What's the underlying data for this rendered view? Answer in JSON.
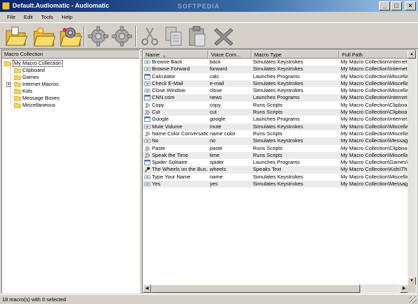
{
  "window": {
    "title": "Default.Audiomatic - Audiomatic",
    "watermark": "SOFTPEDIA",
    "controls": [
      "_",
      "□",
      "×"
    ]
  },
  "menu": [
    "File",
    "Edit",
    "Tools",
    "Help"
  ],
  "toolbar": {
    "buttons": [
      {
        "name": "open-collection",
        "icon": "open-folder-icon"
      },
      {
        "name": "new-folder",
        "icon": "new-folder-icon"
      },
      {
        "name": "folder-settings",
        "icon": "folder-gear-icon"
      },
      {
        "name": "run-macro",
        "icon": "gear-icon"
      },
      {
        "name": "record-macro",
        "icon": "gear-icon"
      },
      {
        "name": "cut",
        "icon": "scissors-icon"
      },
      {
        "name": "copy",
        "icon": "copy-icon"
      },
      {
        "name": "paste",
        "icon": "paste-icon"
      },
      {
        "name": "delete",
        "icon": "delete-x-icon"
      }
    ]
  },
  "tree": {
    "header": "Macro Collection",
    "root": "My Macro Collection",
    "children": [
      "Clipboard",
      "Games",
      "Internet Macros",
      "Kids",
      "Message Boxes",
      "Miscellaneous"
    ],
    "expand_symbol": "+"
  },
  "list": {
    "columns": [
      "Name",
      "Voice Com...",
      "Macro Type",
      "Full Path"
    ],
    "rows": [
      {
        "name": "Browse Back",
        "voice": "back",
        "type": "Simulates Keystrokes",
        "path": "My Macro Collection\\Internet Macro",
        "icon": "keyboard-icon"
      },
      {
        "name": "Browse Forward",
        "voice": "forward",
        "type": "Simulates Keystrokes",
        "path": "My Macro Collection\\Internet Macro",
        "icon": "keyboard-icon"
      },
      {
        "name": "Calculator",
        "voice": "calc",
        "type": "Launches Programs",
        "path": "My Macro Collection\\Miscellaneous\\",
        "icon": "program-icon"
      },
      {
        "name": "Check E-Mail",
        "voice": "e-mail",
        "type": "Simulates Keystrokes",
        "path": "My Macro Collection\\Miscellaneous\\C",
        "icon": "keyboard-icon"
      },
      {
        "name": "Close Window",
        "voice": "close",
        "type": "Simulates Keystrokes",
        "path": "My Macro Collection\\Miscellaneous\\",
        "icon": "keyboard-icon"
      },
      {
        "name": "CNN.com",
        "voice": "news",
        "type": "Launches Programs",
        "path": "My Macro Collection\\Internet Macro",
        "icon": "program-icon"
      },
      {
        "name": "Copy",
        "voice": "copy",
        "type": "Runs Scripts",
        "path": "My Macro Collection\\Clipboard\\Copy",
        "icon": "script-icon"
      },
      {
        "name": "Cut",
        "voice": "cut",
        "type": "Runs Scripts",
        "path": "My Macro Collection\\Clipboard\\Cut\\",
        "icon": "script-icon"
      },
      {
        "name": "Google",
        "voice": "google",
        "type": "Launches Programs",
        "path": "My Macro Collection\\Internet Macro",
        "icon": "program-icon"
      },
      {
        "name": "Mute Volume",
        "voice": "mute",
        "type": "Simulates Keystrokes",
        "path": "My Macro Collection\\Miscellaneous\\",
        "icon": "keyboard-icon"
      },
      {
        "name": "Name Color Conversation",
        "voice": "name color",
        "type": "Runs Scripts",
        "path": "My Macro Collection\\Miscellaneous\\",
        "icon": "script-icon"
      },
      {
        "name": "No",
        "voice": "no",
        "type": "Simulates Keystrokes",
        "path": "My Macro Collection\\Message Boxe",
        "icon": "keyboard-icon"
      },
      {
        "name": "Paste",
        "voice": "paste",
        "type": "Runs Scripts",
        "path": "My Macro Collection\\Clipboard\\Paste",
        "icon": "script-icon"
      },
      {
        "name": "Speak the Time",
        "voice": "time",
        "type": "Runs Scripts",
        "path": "My Macro Collection\\Miscellaneous\\S",
        "icon": "script-icon"
      },
      {
        "name": "Spider Solitaire",
        "voice": "spider",
        "type": "Launches Programs",
        "path": "My Macro Collection\\Games\\Spider S",
        "icon": "program-icon"
      },
      {
        "name": "The Wheels on the Bus...",
        "voice": "wheels",
        "type": "Speaks Text",
        "path": "My Macro Collection\\Kids\\The Whee",
        "icon": "microphone-icon"
      },
      {
        "name": "Type Your Name",
        "voice": "name",
        "type": "Simulates Keystrokes",
        "path": "My Macro Collection\\Miscellaneous\\T",
        "icon": "keyboard-icon"
      },
      {
        "name": "Yes",
        "voice": "yes",
        "type": "Simulates Keystrokes",
        "path": "My Macro Collection\\Message Boxe",
        "icon": "keyboard-icon"
      }
    ]
  },
  "status": "18 macro(s) with 0 selected",
  "colors": {
    "title_gradient_start": "#0a246a",
    "title_gradient_end": "#a6caf0",
    "folder_yellow": "#f4d35e",
    "shaded_row": "#ebebeb",
    "chrome": "#d4d0c8"
  }
}
